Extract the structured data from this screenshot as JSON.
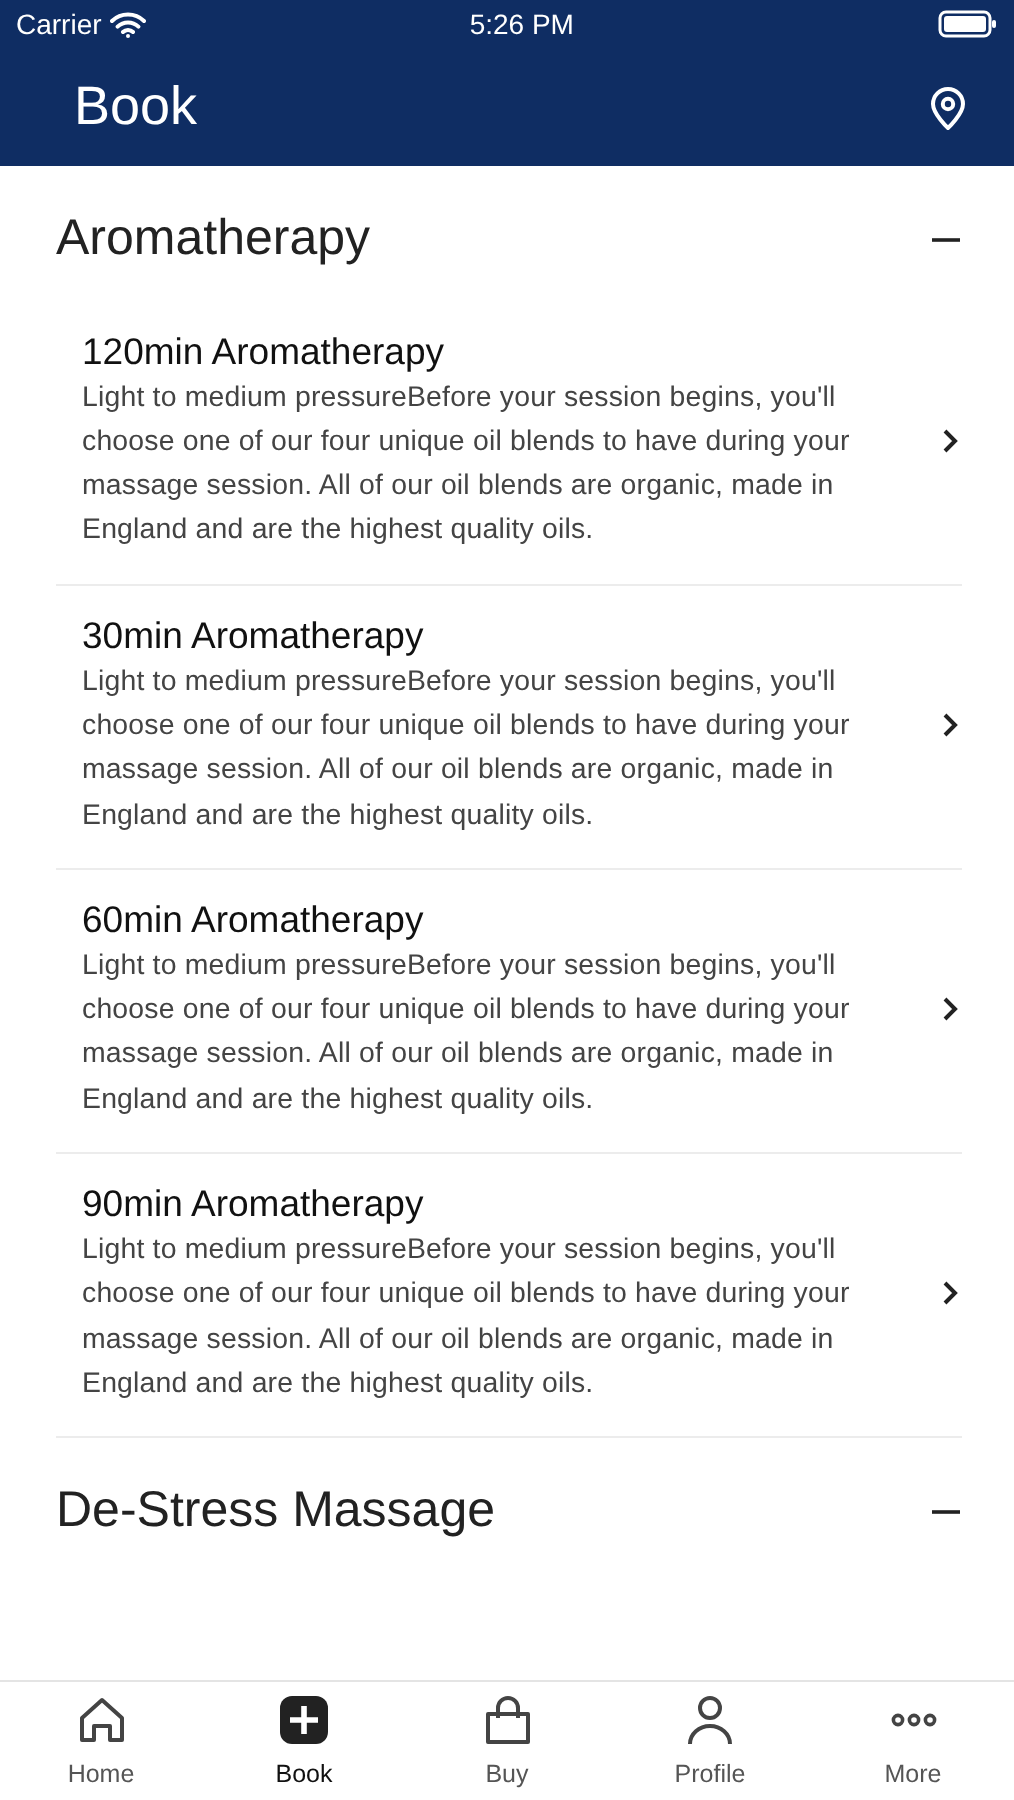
{
  "status_bar": {
    "carrier": "Carrier",
    "time": "5:26 PM"
  },
  "header": {
    "title": "Book"
  },
  "sections": [
    {
      "title": "Aromatherapy",
      "expanded": true,
      "items": [
        {
          "title": "120min Aromatherapy",
          "description": "Light to medium pressureBefore your session begins, you'll choose one of our four unique oil blends to have during your massage session. All of our oil blends are organic, made in England and are the highest quality oils."
        },
        {
          "title": "30min Aromatherapy",
          "description": "Light to medium pressureBefore your session begins, you'll choose one of our four unique oil blends to have during your massage session. All of our oil blends are organic, made in England and are the highest quality oils."
        },
        {
          "title": "60min Aromatherapy",
          "description": "Light to medium pressureBefore your session begins, you'll choose one of our four unique oil blends to have during your massage session. All of our oil blends are organic, made in England and are the highest quality oils."
        },
        {
          "title": "90min Aromatherapy",
          "description": "Light to medium pressureBefore your session begins, you'll choose one of our four unique oil blends to have during your massage session. All of our oil blends are organic, made in England and are the highest quality oils."
        }
      ]
    },
    {
      "title": "De-Stress Massage",
      "expanded": true
    }
  ],
  "tab_bar": [
    {
      "label": "Home",
      "kind": "home",
      "selected": false
    },
    {
      "label": "Book",
      "kind": "book",
      "selected": true
    },
    {
      "label": "Buy",
      "kind": "buy",
      "selected": false
    },
    {
      "label": "Profile",
      "kind": "profile",
      "selected": false
    },
    {
      "label": "More",
      "kind": "more",
      "selected": false
    }
  ]
}
